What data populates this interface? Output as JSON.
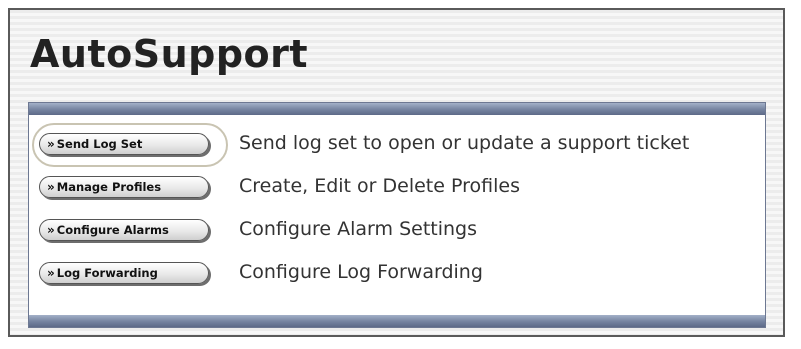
{
  "page": {
    "title": "AutoSupport"
  },
  "actions": [
    {
      "label": "Send Log Set",
      "description": "Send log set to open or update a support ticket",
      "highlighted": true
    },
    {
      "label": "Manage Profiles",
      "description": "Create, Edit or Delete Profiles",
      "highlighted": false
    },
    {
      "label": "Configure Alarms",
      "description": "Configure Alarm Settings",
      "highlighted": false
    },
    {
      "label": "Log Forwarding",
      "description": "Configure Log Forwarding",
      "highlighted": false
    }
  ],
  "icons": {
    "button_prefix": "double-chevron-right-icon"
  },
  "colors": {
    "panel_bar": "#7886a3",
    "title_text": "#222222",
    "highlight_ring": "#c9c4b2"
  }
}
